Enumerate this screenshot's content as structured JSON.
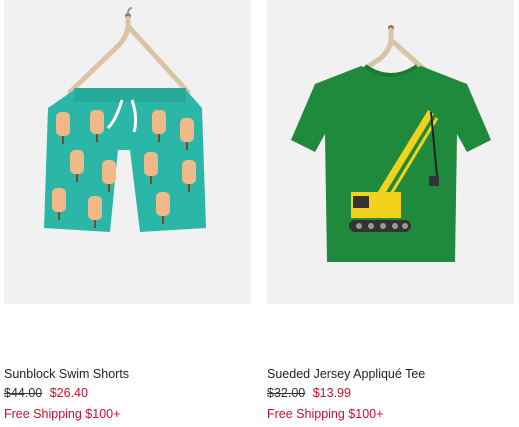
{
  "products": [
    {
      "name": "Sunblock Swim Shorts",
      "original_price": "$44.00",
      "sale_price": "$26.40",
      "shipping": "Free Shipping $100+",
      "image_icon": "swim-shorts-image",
      "colors": {
        "main": "#2bb7a8",
        "pattern": "#f2b988"
      }
    },
    {
      "name": "Sueded Jersey Appliqué Tee",
      "original_price": "$32.00",
      "sale_price": "$13.99",
      "shipping": "Free Shipping $100+",
      "image_icon": "crane-tee-image",
      "colors": {
        "main": "#1f8a3c",
        "pattern": "#f3d21b"
      }
    }
  ],
  "colors": {
    "sale": "#c8102e",
    "image_bg": "#f1f1f1"
  }
}
